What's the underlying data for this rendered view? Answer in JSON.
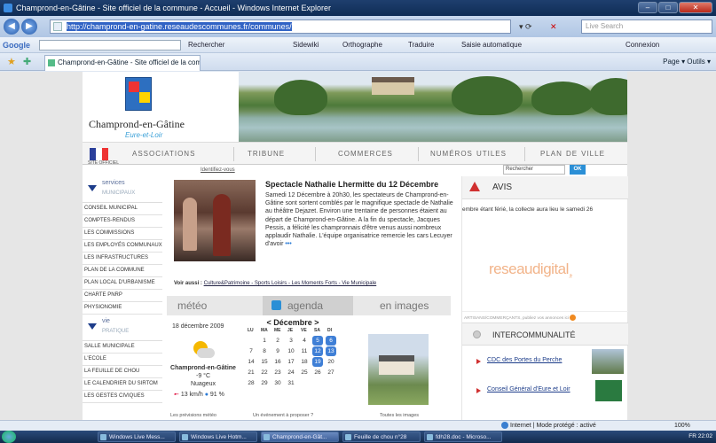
{
  "window": {
    "title": "Champrond-en-Gâtine - Site officiel de la commune - Accueil - Windows Internet Explorer",
    "min": "–",
    "max": "□",
    "close": "✕"
  },
  "address": {
    "url": "http://champrond-en-gatine.reseaudescommunes.fr/communes/",
    "live_search_placeholder": "Live Search"
  },
  "google_toolbar": {
    "logo": "Google",
    "rechercher": "Rechercher",
    "sidewiki": "Sidewiki",
    "orthographe": "Orthographe",
    "traduire": "Traduire",
    "saisie": "Saisie automatique",
    "connexion": "Connexion"
  },
  "tab": {
    "title": "Champrond-en-Gâtine - Site officiel de la comm...",
    "tools": "Page ▾   Outils ▾"
  },
  "site": {
    "town": "Champrond-en-Gâtine",
    "town_sub": "Eure-et-Loir",
    "flag_label": "SITE OFFICIEL",
    "menu": [
      "associations",
      "tribune",
      "commerces",
      "numéros utiles",
      "plan de ville"
    ],
    "identifiez": "Identifiez-vous",
    "search_placeholder": "Rechercher",
    "ok": "OK"
  },
  "nav": {
    "services_line1": "services",
    "services_line2": "municipaux",
    "services_items": [
      "CONSEIL MUNICIPAL",
      "COMPTES-RENDUS",
      "LES COMMISSIONS",
      "LES EMPLOYÉS COMMUNAUX",
      "LES INFRASTRUCTURES",
      "PLAN DE LA COMMUNE",
      "PLAN LOCAL D'URBANISME",
      "CHARTE PNRP",
      "PHYSIONOMIE"
    ],
    "vie_line1": "vie",
    "vie_line2": "pratique",
    "vie_items": [
      "SALLE MUNICIPALE",
      "L'ECOLE",
      "LA FEUILLE DE CHOU",
      "LE CALENDRIER DU SIRTOM",
      "LES GESTES CIVIQUES"
    ]
  },
  "article": {
    "title": "Spectacle Nathalie Lhermitte du 12 Décembre",
    "body": "Samedi 12 Décembre à 20h30, les spectateurs de Champrond-en-Gâtine sont sortent comblés par le magnifique spectacle de Nathalie au théâtre Dejazet. Environ une trentaine de personnes étaient au départ de Champrond-en-Gâtine. A la fin du spectacle, Jacques Pessis, a félicité les champronnais d'être venus aussi nombreux applaudir Nathalie. L'équipe organisatrice remercie les cars Lecuyer d'avoir",
    "more": "•••",
    "voir_label": "Voir aussi :",
    "voir_links": "Culture&Patrimoine - Sports Loisirs - Les Moments Forts - Vie Municipale"
  },
  "widgets": {
    "meteo_tab": "météo",
    "agenda_tab": "agenda",
    "images_tab": "en images",
    "meteo": {
      "date": "18 décembre 2009",
      "place": "Champrond-en-Gâtine",
      "temp": "-9 °C",
      "sky": "Nuageux",
      "wind": "13 km/h",
      "humidity": "91 %",
      "footer": "Les prévisions météo"
    },
    "agenda": {
      "month": "< Décembre >",
      "days": [
        "LU",
        "MA",
        "ME",
        "JE",
        "VE",
        "SA",
        "DI"
      ],
      "rows": [
        [
          "",
          "1",
          "2",
          "3",
          "4",
          "5",
          "6"
        ],
        [
          "7",
          "8",
          "9",
          "10",
          "11",
          "12",
          "13"
        ],
        [
          "14",
          "15",
          "16",
          "17",
          "18",
          "19",
          "20"
        ],
        [
          "21",
          "22",
          "23",
          "24",
          "25",
          "26",
          "27"
        ],
        [
          "28",
          "29",
          "30",
          "31",
          "",
          "",
          ""
        ]
      ],
      "footer": "Un événement à proposer ?"
    },
    "images_footer": "Toutes les images"
  },
  "right": {
    "avis_title": "AVIS",
    "avis_text": "embre étant férié, la collecte aura lieu le samedi 26",
    "reseau_logo": "reseaudigital",
    "reseau_suffix": ".fr",
    "artisans": "ARTISANS/COMMERÇANTS, publiez vos annonces ici",
    "inter_title": "INTERCOMMUNALITÉ",
    "links": [
      "CDC des Portes du Perche",
      "Conseil Général d'Eure et Loir"
    ]
  },
  "status": {
    "zone": "Internet | Mode protégé : activé",
    "zoom": "100%"
  },
  "taskbar": {
    "items": [
      "Windows Live Mess...",
      "Windows Live Hotm...",
      "Champrond-en-Gât...",
      "Feuille de chou n°28",
      "fdh28.doc - Microso..."
    ],
    "tray": "FR   22:02"
  },
  "colors": {
    "accent_blue": "#2b8fd6",
    "nav_blue": "#1d3d8a",
    "alert_red": "#d03030"
  }
}
